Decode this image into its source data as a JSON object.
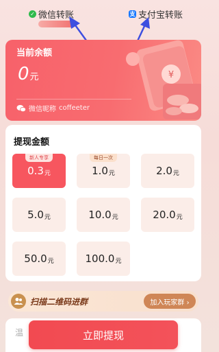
{
  "tabs": {
    "wechat_label": "微信转账",
    "alipay_label": "支付宝转账"
  },
  "balance": {
    "title": "当前余额",
    "amount": "0",
    "unit": "元",
    "nickname_label": "微信昵称",
    "nickname": "coffeeter"
  },
  "amount_section": {
    "title": "提现金额",
    "unit": "元",
    "options": [
      {
        "value": "0.3",
        "tag": "新人专享",
        "selected": true
      },
      {
        "value": "1.0",
        "tag": "每日一次",
        "selected": false
      },
      {
        "value": "2.0",
        "tag": "",
        "selected": false
      },
      {
        "value": "5.0",
        "tag": "",
        "selected": false
      },
      {
        "value": "10.0",
        "tag": "",
        "selected": false
      },
      {
        "value": "20.0",
        "tag": "",
        "selected": false
      },
      {
        "value": "50.0",
        "tag": "",
        "selected": false
      },
      {
        "value": "100.0",
        "tag": "",
        "selected": false
      }
    ]
  },
  "group": {
    "text": "扫描二维码进群",
    "join_label": "加入玩家群 ›"
  },
  "tips": {
    "label": "温"
  },
  "withdraw_button": "立即提现",
  "colors": {
    "accent": "#f24a51",
    "card": "#f86c70",
    "option_bg": "#fbede8",
    "arrow": "#3d4fe0"
  }
}
